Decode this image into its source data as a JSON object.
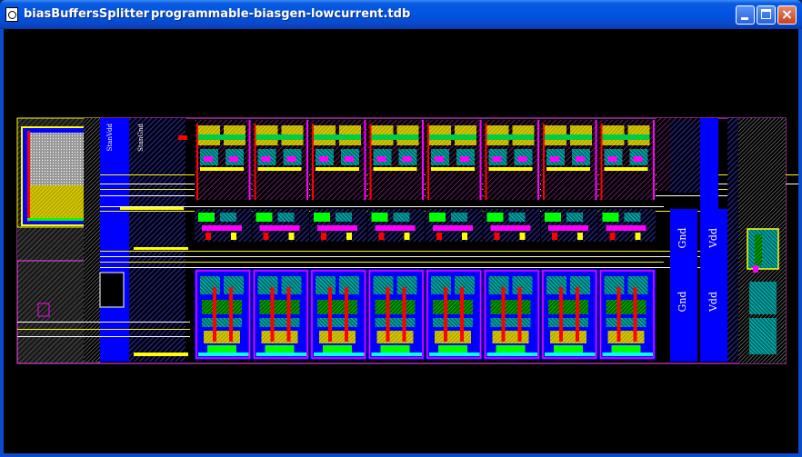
{
  "window": {
    "app_title": "biasBuffersSplitter",
    "file_title": "programmable-biasgen-lowcurrent.tdb",
    "buttons": {
      "minimize": "minimize",
      "maximize": "maximize",
      "close": "close"
    }
  },
  "layout": {
    "rail_labels": [
      "StanVdd",
      "StanGnd"
    ],
    "right_labels": [
      "Gnd",
      "Vdd",
      "Gnd",
      "Vdd"
    ],
    "cell_columns": 8,
    "colors": {
      "background": "#000000",
      "metal_blue": "#0000ff",
      "poly_red": "#ff0000",
      "diff_green": "#00ff00",
      "well_yellow": "#ffff00",
      "contact_cyan": "#00ffff",
      "cell_magenta": "#ff00ff",
      "outline_white": "#ffffff"
    }
  }
}
